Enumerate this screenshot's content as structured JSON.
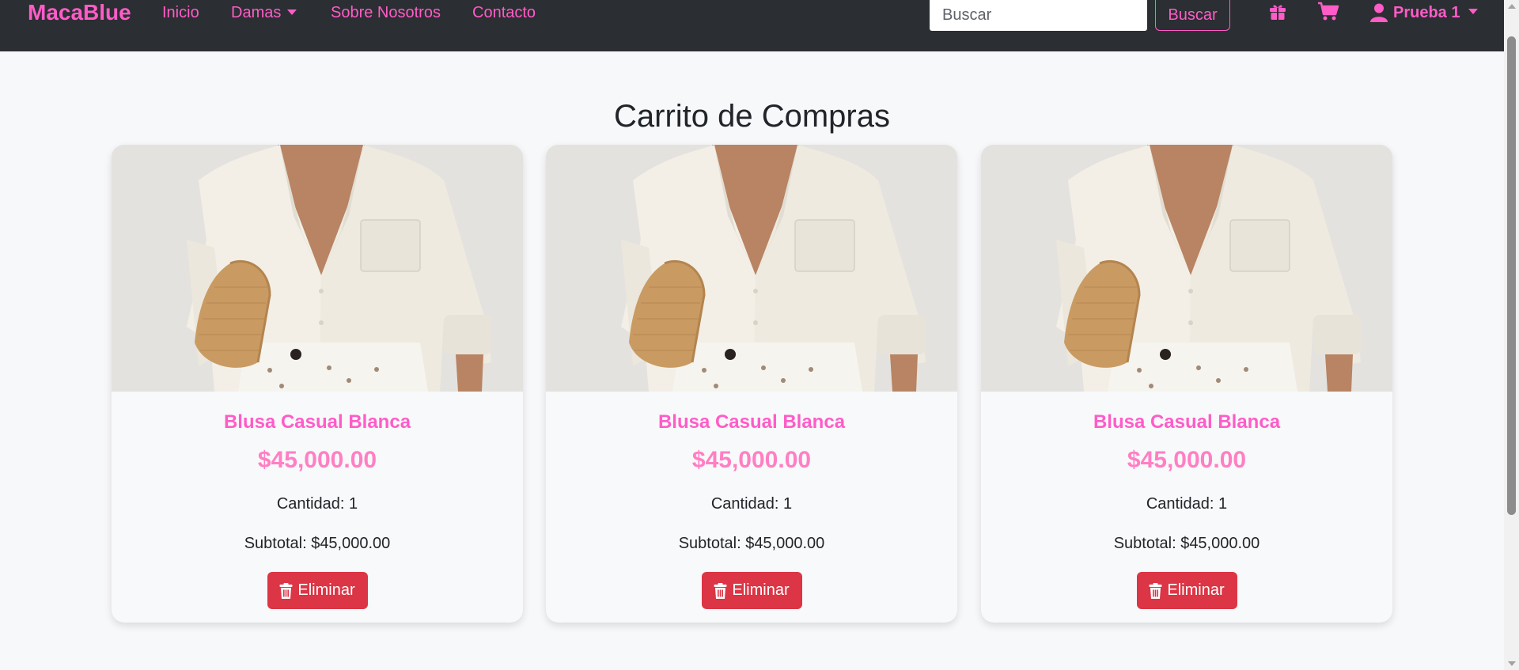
{
  "navbar": {
    "brand": "MacaBlue",
    "links": [
      "Inicio",
      "Damas",
      "Sobre Nosotros",
      "Contacto"
    ],
    "search": {
      "placeholder": "Buscar",
      "value": "",
      "button_label": "Buscar"
    },
    "icons": [
      "gift-icon",
      "cart-icon"
    ],
    "user": {
      "label": "Prueba 1",
      "icon": "user-icon"
    }
  },
  "main": {
    "title": "Carrito de Compras",
    "cart_items": [
      {
        "name": "Blusa Casual Blanca",
        "price": "$45,000.00",
        "quantity": "Cantidad: 1",
        "subtotal": "Subtotal: $45,000.00",
        "delete_label": "Eliminar"
      },
      {
        "name": "Blusa Casual Blanca",
        "price": "$45,000.00",
        "quantity": "Cantidad: 1",
        "subtotal": "Subtotal: $45,000.00",
        "delete_label": "Eliminar"
      },
      {
        "name": "Blusa Casual Blanca",
        "price": "$45,000.00",
        "quantity": "Cantidad: 1",
        "subtotal": "Subtotal: $45,000.00",
        "delete_label": "Eliminar"
      }
    ]
  },
  "colors": {
    "navbar_bg": "#2b2e32",
    "accent_pink": "#ff5cc8",
    "price_pink": "#ff7fc4",
    "danger": "#dc3545",
    "page_bg": "#f7f8fa"
  }
}
